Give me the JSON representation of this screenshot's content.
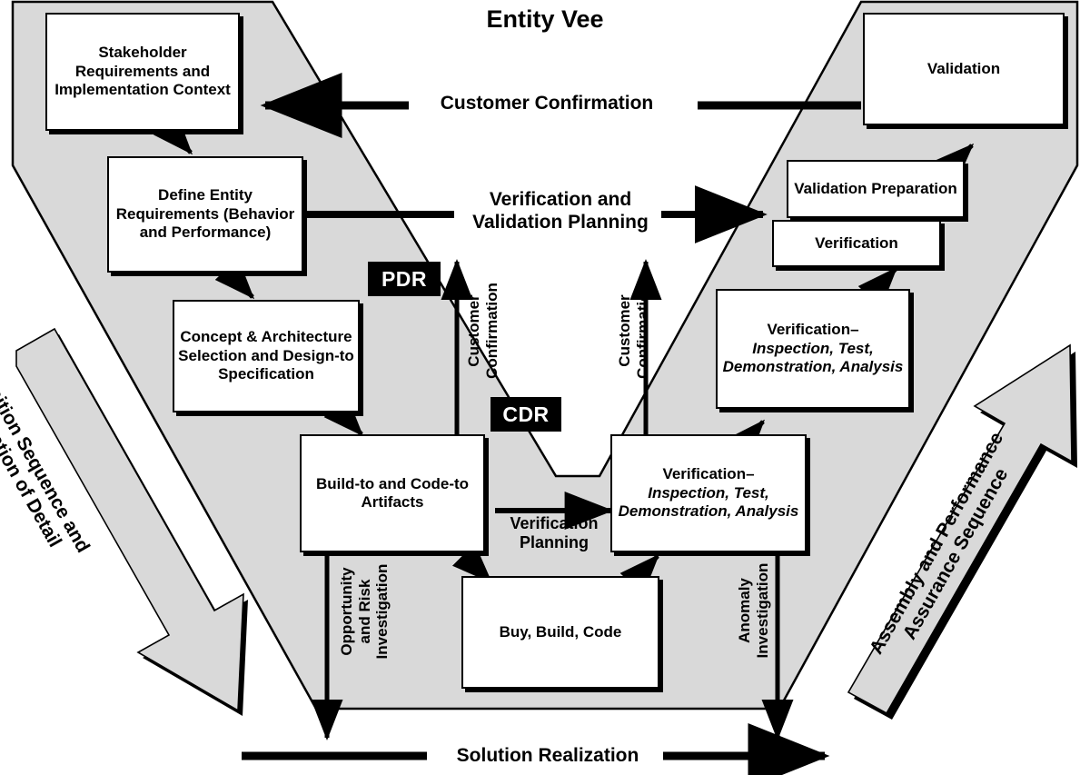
{
  "diagram": {
    "title": "Entity Vee",
    "background_color": "#ffffff",
    "vee_fill_color": "#d9d9d9",
    "line_color": "#000000",
    "milestone_bg_color": "#000000",
    "milestone_text_color": "#ffffff"
  },
  "boxes": {
    "stakeholder_requirements": "Stakeholder\nRequirements\nand\nImplementation\nContext",
    "define_entity_requirements": "Define Entity\nRequirements\n(Behavior and\nPerformance)",
    "concept_architecture": "Concept &\nArchitecture\nSelection and\nDesign-to\nSpecification",
    "build_to_code_to": "Build-to\nand\nCode-to\nArtifacts",
    "buy_build_code": "Buy,\nBuild,\nCode",
    "validation": "Validation",
    "validation_preparation": "Validation\nPreparation",
    "verification": "Verification",
    "verification_methods_upper_head": "Verification–",
    "verification_methods_upper_body": "Inspection, Test,\nDemonstration,\nAnalysis",
    "verification_methods_lower_head": "Verification–",
    "verification_methods_lower_body": "Inspection, Test,\nDemonstration,\nAnalysis"
  },
  "milestones": {
    "pdr": "PDR",
    "cdr": "CDR"
  },
  "flow_labels": {
    "customer_confirmation_top": "Customer Confirmation",
    "verification_and_validation_planning": "Verification and\nValidation Planning",
    "verification_planning": "Verification\nPlanning",
    "solution_realization": "Solution Realization",
    "customer_confirmation_left_vertical": "Customer\nConfirmation",
    "customer_confirmation_right_vertical": "Customer\nConfirmation",
    "opportunity_and_risk_investigation": "Opportunity\nand Risk\nInvestigation",
    "anomaly_investigation": "Anomaly\nInvestigation"
  },
  "banners": {
    "left_descending": "Definition Sequence and\nElaboration of Detail",
    "right_ascending": "Assembly and Performance\nAssurance Sequence"
  }
}
